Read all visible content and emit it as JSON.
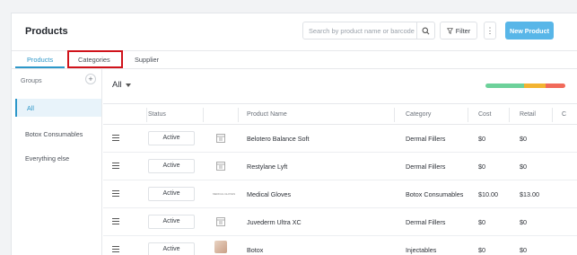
{
  "header": {
    "title": "Products",
    "search_placeholder": "Search by product name or barcode",
    "filter_label": "Filter",
    "more_label": "⋮",
    "new_product_label": "New Product"
  },
  "tabs": [
    {
      "label": "Products",
      "active": true
    },
    {
      "label": "Categories",
      "active": false
    },
    {
      "label": "Supplier",
      "active": false
    }
  ],
  "sidebar": {
    "groups_label": "Groups",
    "add_label": "+",
    "items": [
      {
        "label": "All",
        "active": true
      },
      {
        "label": "Botox Consumables",
        "active": false
      },
      {
        "label": "Everything else",
        "active": false
      }
    ]
  },
  "main": {
    "group_filter": "All",
    "stock_bar": [
      {
        "color": "#6dd19a",
        "fraction": 0.48
      },
      {
        "color": "#f2b331",
        "fraction": 0.27
      },
      {
        "color": "#f16a5a",
        "fraction": 0.25
      }
    ],
    "columns": [
      "Status",
      "Product Name",
      "Category",
      "Cost",
      "Retail",
      "C"
    ],
    "rows": [
      {
        "status": "Active",
        "thumb": "image-placeholder",
        "name": "Belotero Balance Soft",
        "category": "Dermal Fillers",
        "cost": "$0",
        "retail": "$0"
      },
      {
        "status": "Active",
        "thumb": "image-placeholder",
        "name": "Restylane Lyft",
        "category": "Dermal Fillers",
        "cost": "$0",
        "retail": "$0"
      },
      {
        "status": "Active",
        "thumb": "image-text",
        "thumb_text": "MEDICAL GLOVES",
        "name": "Medical Gloves",
        "category": "Botox Consumables",
        "cost": "$10.00",
        "retail": "$13.00"
      },
      {
        "status": "Active",
        "thumb": "image-placeholder",
        "name": "Juvederm Ultra XC",
        "category": "Dermal Fillers",
        "cost": "$0",
        "retail": "$0"
      },
      {
        "status": "Active",
        "thumb": "image-photo",
        "name": "Botox",
        "category": "Injectables",
        "cost": "$0",
        "retail": "$0"
      }
    ]
  }
}
